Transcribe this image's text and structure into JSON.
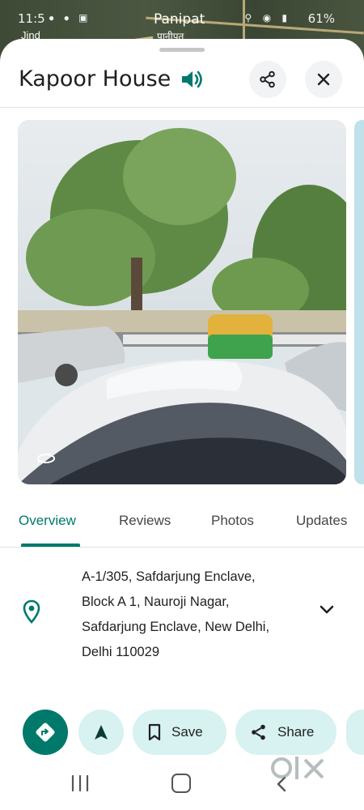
{
  "status_bar": {
    "time": "11:5",
    "battery": "61%"
  },
  "map": {
    "city": "Panipat",
    "city_local": "पानीपत",
    "town": "Jind"
  },
  "place": {
    "title": "Kapoor House"
  },
  "tabs": [
    {
      "label": "Overview",
      "active": true
    },
    {
      "label": "Reviews",
      "active": false
    },
    {
      "label": "Photos",
      "active": false
    },
    {
      "label": "Updates",
      "active": false
    }
  ],
  "address": {
    "lines": [
      "A-1/305, Safdarjung Enclave,",
      "Block A 1, Nauroji Nagar,",
      "Safdarjung Enclave, New Delhi,",
      "Delhi 110029"
    ]
  },
  "actions": {
    "save_label": "Save",
    "share_label": "Share"
  },
  "icons": {
    "directions": "directions-icon",
    "start": "navigation-arrow-icon",
    "save": "bookmark-icon",
    "share": "share-icon",
    "close": "close-icon",
    "speaker": "speaker-icon",
    "location": "location-pin-icon"
  },
  "colors": {
    "accent": "#00796b",
    "pill_bg": "#d7f2f0",
    "circle_bg": "#f1f3f4"
  },
  "watermark": {
    "text": "olx"
  }
}
